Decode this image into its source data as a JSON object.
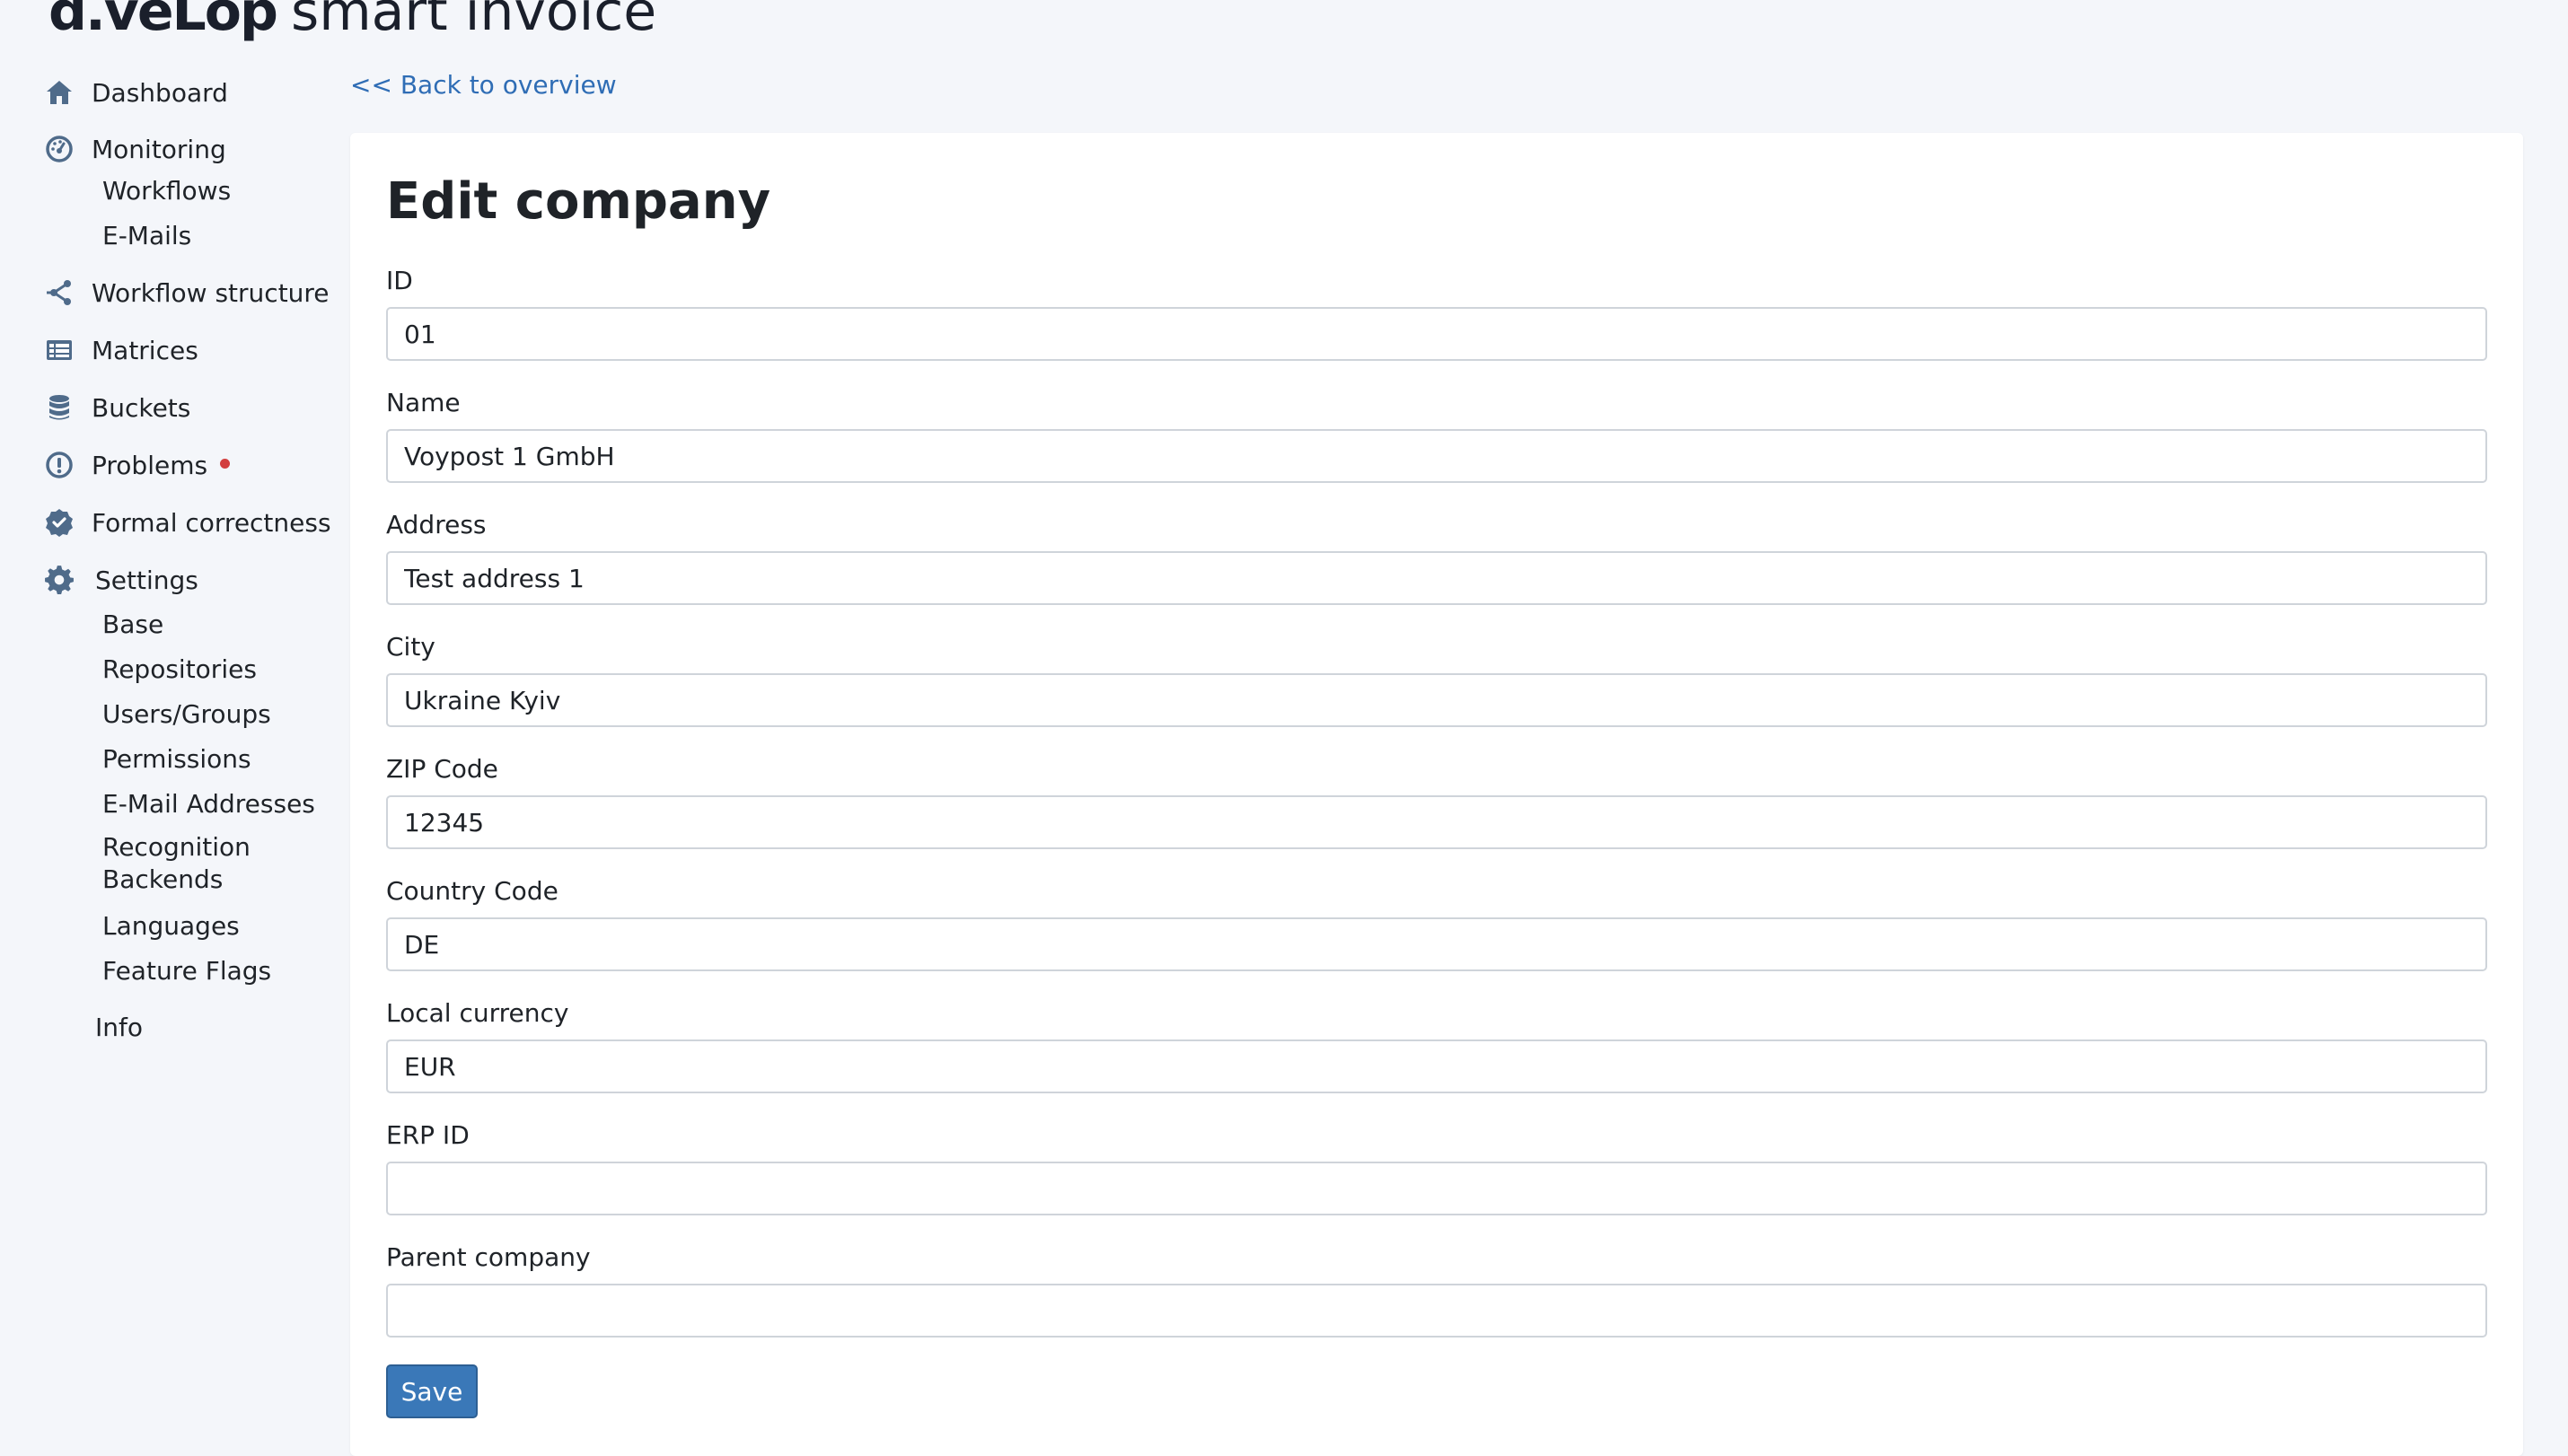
{
  "app": {
    "brand": "d.veLop",
    "product": "smart invoice"
  },
  "sidebar": {
    "items": [
      {
        "label": "Dashboard",
        "icon": "home-icon"
      },
      {
        "label": "Monitoring",
        "icon": "gauge-icon",
        "children": [
          "Workflows",
          "E-Mails"
        ]
      },
      {
        "label": "Workflow structure",
        "icon": "workflow-icon"
      },
      {
        "label": "Matrices",
        "icon": "table-icon"
      },
      {
        "label": "Buckets",
        "icon": "database-icon"
      },
      {
        "label": "Problems",
        "icon": "alert-circle-icon",
        "has_alert_dot": true
      },
      {
        "label": "Formal correctness",
        "icon": "check-badge-icon"
      },
      {
        "label": "Settings",
        "icon": "gear-icon",
        "children": [
          "Base",
          "Repositories",
          "Users/Groups",
          "Permissions",
          "E-Mail Addresses",
          "Recognition Backends",
          "Languages",
          "Feature Flags"
        ]
      },
      {
        "label": "Info",
        "icon": ""
      }
    ]
  },
  "main": {
    "back_link": "<< Back to overview",
    "title": "Edit company",
    "fields": [
      {
        "label": "ID",
        "value": "01"
      },
      {
        "label": "Name",
        "value": "Voypost 1 GmbH"
      },
      {
        "label": "Address",
        "value": "Test address 1"
      },
      {
        "label": "City",
        "value": "Ukraine Kyiv"
      },
      {
        "label": "ZIP Code",
        "value": "12345"
      },
      {
        "label": "Country Code",
        "value": "DE"
      },
      {
        "label": "Local currency",
        "value": "EUR"
      },
      {
        "label": "ERP ID",
        "value": ""
      },
      {
        "label": "Parent company",
        "value": ""
      }
    ],
    "save_label": "Save"
  },
  "colors": {
    "background": "#f4f6fa",
    "link": "#2f6db5",
    "icon": "#4f6b8a",
    "primary_button": "#3a78b8",
    "alert_dot": "#d23f3f"
  }
}
